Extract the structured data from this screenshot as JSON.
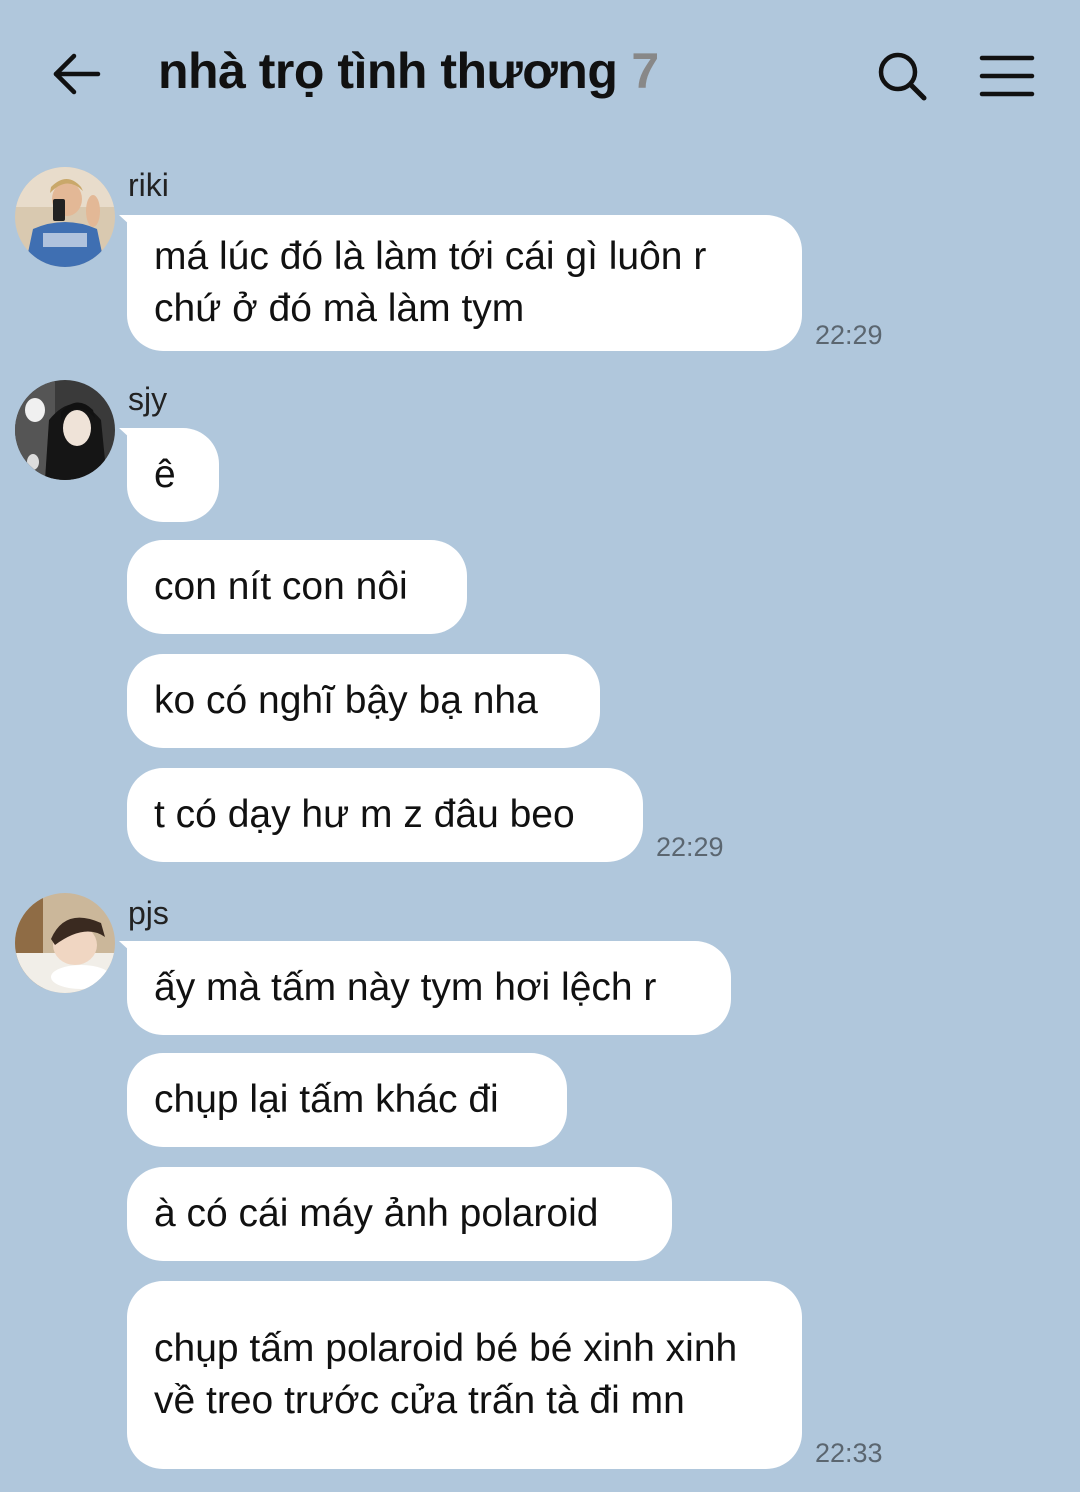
{
  "header": {
    "title": "nhà trọ tình thương",
    "member_count": "7"
  },
  "groups": [
    {
      "sender": "riki",
      "messages": [
        "má lúc đó là làm tới cái gì luôn r chứ ở đó mà làm tym"
      ],
      "time": "22:29"
    },
    {
      "sender": "sjy",
      "messages": [
        "ê",
        "con nít con nôi",
        "ko có nghĩ bậy bạ nha",
        "t có dạy hư m z đâu beo"
      ],
      "time": "22:29"
    },
    {
      "sender": "pjs",
      "messages": [
        "ấy mà tấm này tym hơi lệch r",
        "chụp lại tấm khác đi",
        "à có cái máy ảnh polaroid",
        "chụp tấm polaroid bé bé xinh xinh về treo trước cửa trấn tà đi mn"
      ],
      "time": "22:33"
    }
  ],
  "colors": {
    "background": "#b0c7dc",
    "bubble": "#ffffff",
    "time_text": "#5b6670",
    "member_count": "#888888"
  },
  "icons": [
    "back-arrow-icon",
    "search-icon",
    "menu-icon"
  ]
}
